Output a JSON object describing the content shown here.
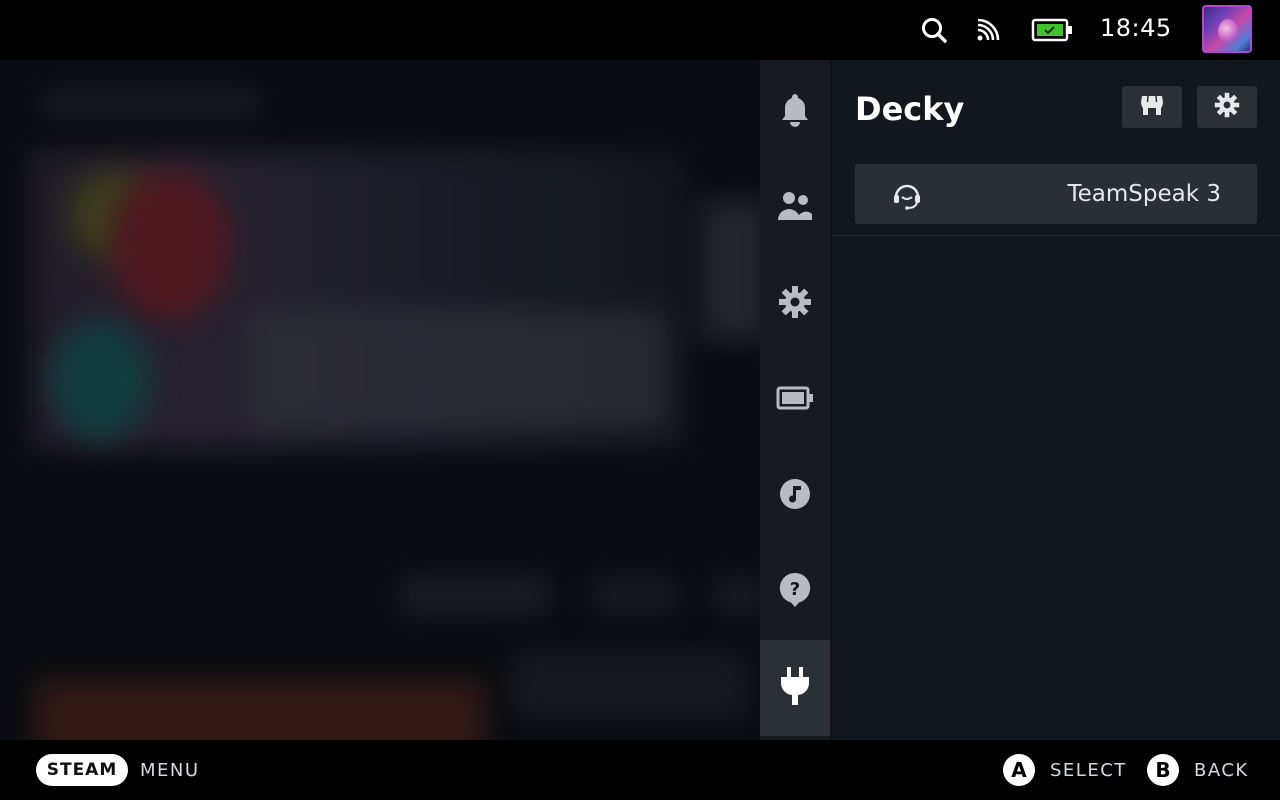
{
  "topbar": {
    "clock": "18:45",
    "icons": [
      "search-icon",
      "cast-icon",
      "battery-charging-icon"
    ],
    "battery_color": "#3fc52a"
  },
  "sidenav": {
    "items": [
      {
        "name": "notifications",
        "icon": "bell-icon"
      },
      {
        "name": "friends",
        "icon": "friends-icon"
      },
      {
        "name": "settings",
        "icon": "gear-icon"
      },
      {
        "name": "performance",
        "icon": "battery-icon"
      },
      {
        "name": "music",
        "icon": "music-icon"
      },
      {
        "name": "help",
        "icon": "help-icon"
      },
      {
        "name": "plugins",
        "icon": "plug-icon",
        "active": true
      }
    ]
  },
  "panel": {
    "title": "Decky",
    "buttons": [
      "store-icon",
      "gear-icon"
    ],
    "plugins": [
      {
        "label": "TeamSpeak 3",
        "icon": "headset-icon"
      }
    ]
  },
  "bottombar": {
    "steam_label": "STEAM",
    "menu_label": "MENU",
    "a_glyph": "A",
    "select_label": "SELECT",
    "b_glyph": "B",
    "back_label": "BACK"
  }
}
